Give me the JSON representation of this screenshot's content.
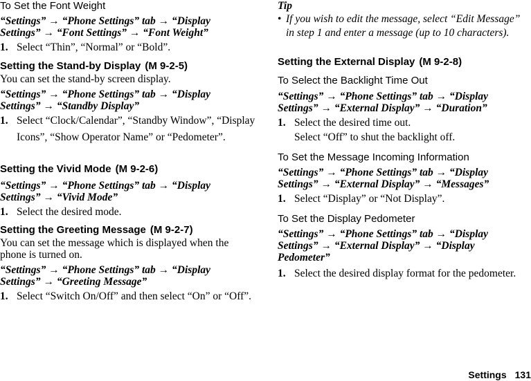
{
  "left_column": {
    "font_weight": {
      "subtitle": "To Set the Font Weight",
      "path": "“Settings” → “Phone Settings” tab → “Display Settings” → “Font Settings” → “Font Weight”",
      "step_num": "1.",
      "step_text": "Select “Thin”, “Normal” or “Bold”."
    },
    "standby": {
      "title": "Setting the Stand-by Display",
      "ref": "(M 9-2-5)",
      "desc": "You can set the stand-by screen display.",
      "path": "“Settings” → “Phone Settings” tab → “Display Settings” → “Standby Display”",
      "step_num": "1.",
      "step_text": "Select “Clock/Calendar”, “Standby Window”, “Display Icons”, “Show Operator Name” or “Pedometer”."
    },
    "vivid": {
      "title": "Setting the Vivid Mode",
      "ref": "(M 9-2-6)",
      "path": "“Settings” → “Phone Settings” tab → “Display Settings” → “Vivid Mode”",
      "step_num": "1.",
      "step_text": "Select the desired mode."
    },
    "greeting": {
      "title": "Setting the Greeting Message",
      "ref": "(M 9-2-7)",
      "desc": "You can set the message which is displayed when the phone is turned on.",
      "path": "“Settings” → “Phone Settings” tab → “Display Settings” → “Greeting Message”",
      "step_num": "1.",
      "step_text": "Select “Switch On/Off” and then select “On” or “Off”."
    }
  },
  "right_column": {
    "tip": {
      "title": "Tip",
      "bullet": "•",
      "text": "If you wish to edit the message, select “Edit Message” in step 1 and enter a message (up to 10 characters)."
    },
    "external": {
      "title": "Setting the External Display",
      "ref": "(M 9-2-8)"
    },
    "backlight": {
      "subtitle": "To Select the Backlight Time Out",
      "path": "“Settings” → “Phone Settings” tab → “Display Settings” → “External Display” → “Duration”",
      "step_num": "1.",
      "step_text": "Select the desired time out.",
      "note": "Select “Off” to shut the backlight off."
    },
    "message_info": {
      "subtitle": "To Set the Message Incoming Information",
      "path": "“Settings” → “Phone Settings” tab → “Display Settings” → “External Display” → “Messages”",
      "step_num": "1.",
      "step_text": "Select “Display” or “Not Display”."
    },
    "pedometer": {
      "subtitle": "To Set the Display Pedometer",
      "path": "“Settings” → “Phone Settings” tab → “Display Settings” → “External Display” → “Display Pedometer”",
      "step_num": "1.",
      "step_text": "Select the desired display format for the pedometer."
    }
  },
  "footer": {
    "section": "Settings",
    "page": "131"
  }
}
